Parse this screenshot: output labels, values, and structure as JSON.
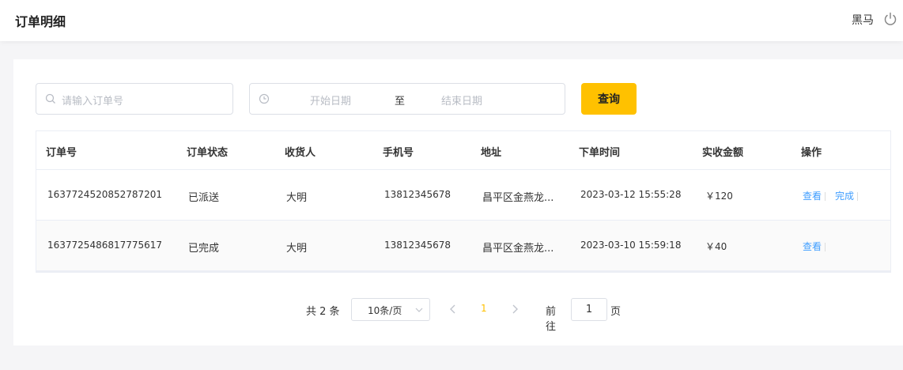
{
  "header": {
    "title": "订单明细",
    "user": "黑马"
  },
  "filters": {
    "order_placeholder": "请输入订单号",
    "start_date_placeholder": "开始日期",
    "range_separator": "至",
    "end_date_placeholder": "结束日期",
    "query_label": "查询"
  },
  "table": {
    "headers": [
      "订单号",
      "订单状态",
      "收货人",
      "手机号",
      "地址",
      "下单时间",
      "实收金额",
      "操作"
    ],
    "rows": [
      {
        "order_no": "1637724520852787201",
        "status": "已派送",
        "receiver": "大明",
        "phone": "13812345678",
        "address": "昌平区金燕龙...",
        "time": "2023-03-12 15:55:28",
        "amount": "￥120",
        "actions": [
          "查看",
          "完成"
        ]
      },
      {
        "order_no": "1637725486817775617",
        "status": "已完成",
        "receiver": "大明",
        "phone": "13812345678",
        "address": "昌平区金燕龙...",
        "time": "2023-03-10 15:59:18",
        "amount": "￥40",
        "actions": [
          "查看"
        ]
      }
    ]
  },
  "pagination": {
    "total": "共 2 条",
    "page_size": "10条/页",
    "current": "1",
    "goto_label": "前往",
    "goto_value": "1",
    "goto_unit": "页"
  },
  "colors": {
    "accent": "#ffc100",
    "link": "#409eff"
  },
  "icons": [
    "power-icon",
    "search-icon",
    "clock-icon",
    "chevron-down-icon",
    "chevron-left-icon",
    "chevron-right-icon"
  ]
}
